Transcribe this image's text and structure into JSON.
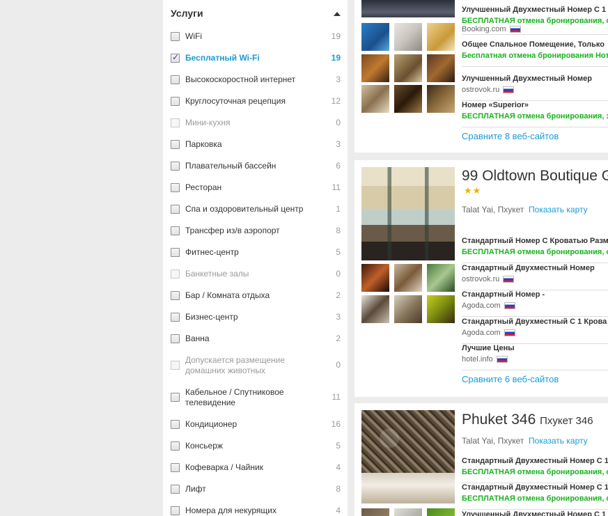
{
  "filters": {
    "title": "Услуги",
    "items": [
      {
        "label": "WiFi",
        "count": "19",
        "checked": false,
        "disabled": false
      },
      {
        "label": "Бесплатный Wi-Fi",
        "count": "19",
        "checked": true,
        "disabled": false
      },
      {
        "label": "Высокоскоростной интернет",
        "count": "3",
        "checked": false,
        "disabled": false
      },
      {
        "label": "Круглосуточная рецепция",
        "count": "12",
        "checked": false,
        "disabled": false
      },
      {
        "label": "Мини-кухня",
        "count": "0",
        "checked": false,
        "disabled": true
      },
      {
        "label": "Парковка",
        "count": "3",
        "checked": false,
        "disabled": false
      },
      {
        "label": "Плавательный бассейн",
        "count": "6",
        "checked": false,
        "disabled": false
      },
      {
        "label": "Ресторан",
        "count": "11",
        "checked": false,
        "disabled": false
      },
      {
        "label": "Спа и оздоровительный центр",
        "count": "1",
        "checked": false,
        "disabled": false
      },
      {
        "label": "Трансфер из/в аэропорт",
        "count": "8",
        "checked": false,
        "disabled": false
      },
      {
        "label": "Фитнес-центр",
        "count": "5",
        "checked": false,
        "disabled": false
      },
      {
        "label": "Банкетные залы",
        "count": "0",
        "checked": false,
        "disabled": true
      },
      {
        "label": "Бар / Комната отдыха",
        "count": "2",
        "checked": false,
        "disabled": false
      },
      {
        "label": "Бизнес-центр",
        "count": "3",
        "checked": false,
        "disabled": false
      },
      {
        "label": "Ванна",
        "count": "2",
        "checked": false,
        "disabled": false
      },
      {
        "label": "Допускается размещение домашних животных",
        "count": "0",
        "checked": false,
        "disabled": true
      },
      {
        "label": "Кабельное / Спутниковое телевидение",
        "count": "11",
        "checked": false,
        "disabled": false
      },
      {
        "label": "Кондиционер",
        "count": "16",
        "checked": false,
        "disabled": false
      },
      {
        "label": "Консьерж",
        "count": "5",
        "checked": false,
        "disabled": false
      },
      {
        "label": "Кофеварка / Чайник",
        "count": "4",
        "checked": false,
        "disabled": false
      },
      {
        "label": "Лифт",
        "count": "8",
        "checked": false,
        "disabled": false
      },
      {
        "label": "Номера для некурящих",
        "count": "4",
        "checked": false,
        "disabled": false
      }
    ]
  },
  "hotels": [
    {
      "deals": [
        {
          "name": "Улучшенный Двухместный Номер С 1",
          "green": "БЕСПЛАТНАЯ отмена бронирования, о",
          "source": ""
        },
        {
          "name": "",
          "green": "",
          "source": "Booking.com"
        },
        {
          "name": "Общее Спальное Помещение, Только",
          "green": "Бесплатная отмена бронирования Нот",
          "source": ""
        },
        {
          "name": "Улучшенный Двухместный Номер",
          "green": "",
          "source": "ostrovok.ru"
        },
        {
          "name": "Номер «Superior»",
          "green": "БЕСПЛАТНАЯ отмена бронирования, з",
          "source": ""
        }
      ],
      "compare": "Сравните 8 веб-сайтов"
    },
    {
      "name": "99 Oldtown Boutique G",
      "stars": "★★",
      "location": "Talat Yai, Пхукет",
      "map_link": "Показать карту",
      "deals": [
        {
          "name": "Стандартный Номер С Кроватью Разм",
          "green": "БЕСПЛАТНАЯ отмена бронирования, о",
          "source": ""
        },
        {
          "name": "Стандартный Двухместный Номер",
          "green": "",
          "source": "ostrovok.ru"
        },
        {
          "name": "Стандартный Номер -",
          "green": "",
          "source": "Agoda.com"
        },
        {
          "name": "Стандартный Двухместный С 1 Крова",
          "green": "",
          "source": "Agoda.com"
        },
        {
          "name": "Лучшие Цены",
          "green": "",
          "source": "hotel.info"
        }
      ],
      "compare": "Сравните 6 веб-сайтов"
    },
    {
      "name": "Phuket 346",
      "subname": "Пхукет 346",
      "location": "Talat Yai, Пхукет",
      "map_link": "Показать карту",
      "deals": [
        {
          "name": "Стандартный Двухместный Номер С 1",
          "green": "БЕСПЛАТНАЯ отмена бронирования, о",
          "source": ""
        },
        {
          "name": "Стандартный Двухместный Номер С 1",
          "green": "БЕСПЛАТНАЯ отмена бронирования, о",
          "source": ""
        },
        {
          "name": "Улучшенный Двухместный Номер С 1",
          "green": "",
          "source": ""
        }
      ]
    }
  ]
}
